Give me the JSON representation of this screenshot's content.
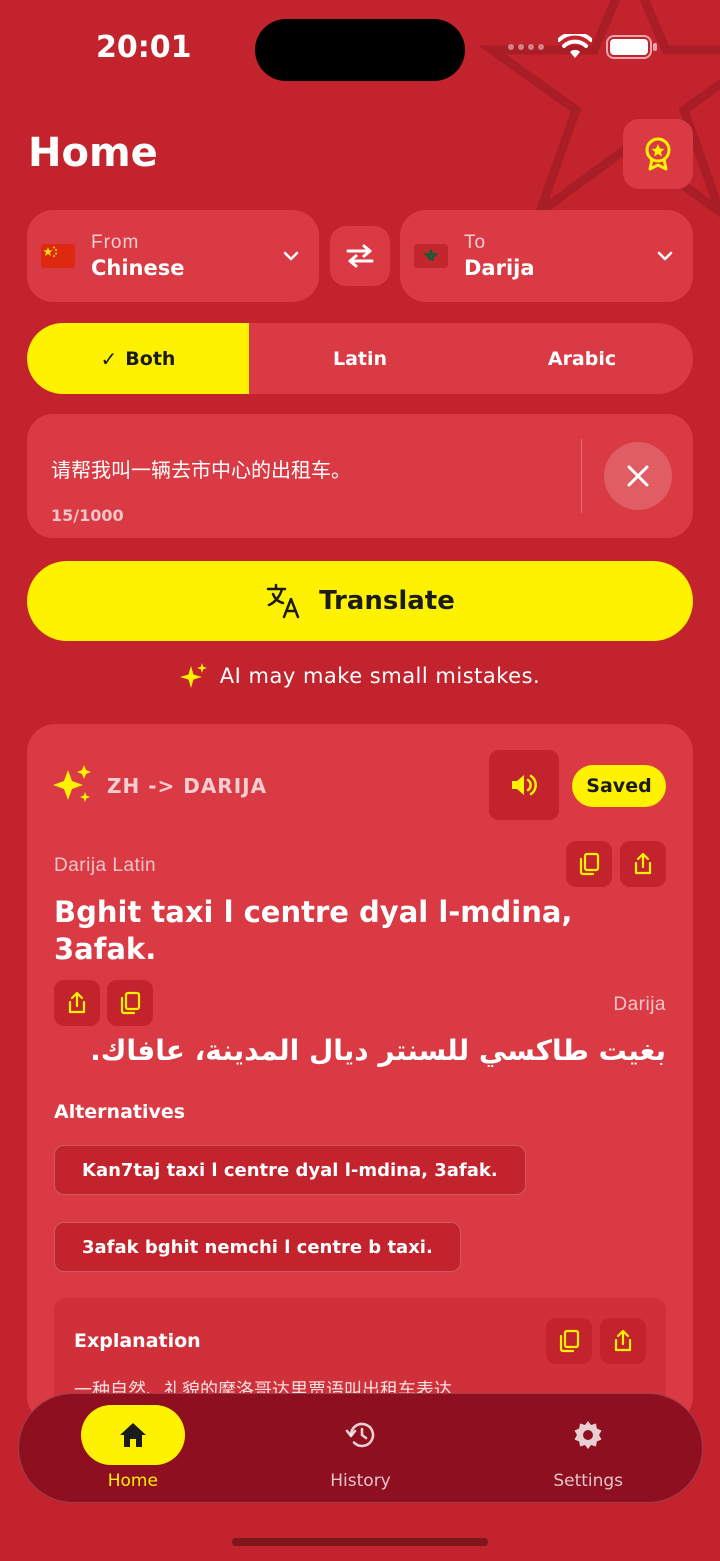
{
  "status_bar": {
    "time": "20:01"
  },
  "header": {
    "title": "Home"
  },
  "from_lang": {
    "caption": "From",
    "value": "Chinese"
  },
  "to_lang": {
    "caption": "To",
    "value": "Darija"
  },
  "script_toggle": {
    "both": "Both",
    "latin": "Latin",
    "arabic": "Arabic",
    "selected": "Both"
  },
  "input": {
    "text": "请帮我叫一辆去市中心的出租车。",
    "count": "15/1000"
  },
  "translate": {
    "label": "Translate"
  },
  "ai_note": "AI may make small mistakes.",
  "result": {
    "pair": "ZH -> DARIJA",
    "saved": "Saved",
    "latin_caption": "Darija Latin",
    "latin_text": "Bghit taxi l centre dyal l-mdina, 3afak.",
    "arabic_caption": "Darija",
    "arabic_text": "بغيت طاكسي للسنتر ديال المدينة، عافاك.",
    "alternatives_heading": "Alternatives",
    "alternatives": [
      "Kan7taj taxi l centre dyal l-mdina, 3afak.",
      "3afak bghit nemchi l centre b taxi."
    ],
    "explanation_heading": "Explanation",
    "explanation_text": "一种自然、礼貌的摩洛哥达里贾语叫出租车表达"
  },
  "nav": {
    "home": "Home",
    "history": "History",
    "settings": "Settings",
    "active": "home"
  },
  "colors": {
    "background": "#c2232c",
    "card": "#d93a43",
    "accent": "#fff200",
    "nav": "#8e1020"
  }
}
